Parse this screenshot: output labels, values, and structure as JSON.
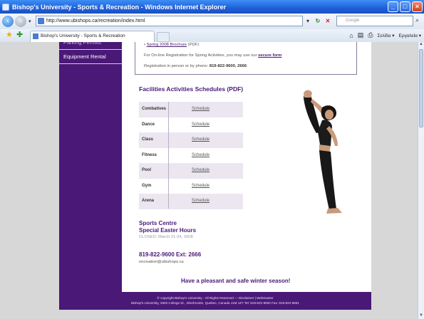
{
  "window": {
    "title": "Bishop's University - Sports & Recreation - Windows Internet Explorer"
  },
  "browser": {
    "url": "http://www.ubishops.ca/recreation/index.html",
    "search_placeholder": "Google",
    "tab_title": "Bishop's University - Sports & Recreation",
    "cmd_page": "Σελίδα",
    "cmd_tools": "Εργαλεία"
  },
  "sidebar": {
    "items": [
      {
        "label": "Parking Permits"
      },
      {
        "label": "Equipment Rental"
      }
    ]
  },
  "info": {
    "brochure_link": "Spring 2008 Brochure",
    "brochure_suffix": "(PDF)",
    "online_text": "For On-line Registration for Spring Activities, you may use our",
    "secure_link": "secure form",
    "phone_text": "Registration in person or by phone:",
    "phone_number": "819-822-9600, 2666"
  },
  "schedules": {
    "title": "Facilities Activities Schedules   (PDF)",
    "rows": [
      {
        "name": "Combatives",
        "link": "Schedule"
      },
      {
        "name": "Dance",
        "link": "Schedule"
      },
      {
        "name": "Class",
        "link": "Schedule"
      },
      {
        "name": "Fitness",
        "link": "Schedule"
      },
      {
        "name": "Pool",
        "link": "Schedule"
      },
      {
        "name": "Gym",
        "link": "Schedule"
      },
      {
        "name": "Arena",
        "link": "Schedule"
      }
    ]
  },
  "centre": {
    "line1": "Sports Centre",
    "line2": "Special Easter Hours",
    "closed": "CLOSED: March 21-24, 2008",
    "phone": "819-822-9600 Ext: 2666",
    "email": "recreation@ubishops.ca"
  },
  "season_message": "Have a pleasant and safe winter season!",
  "footer": {
    "line1": "© copyright Bishop's University - All Rights Reserved   —   Disclaimer  |  Webmaster",
    "line2": "Bishop's University, 2600 College St., Sherbrooke, Quebec, Canada J1M 1Z7   Tel: 819-822-9600   Fax: 819-822-9661"
  },
  "colors": {
    "brand_purple": "#4a1877",
    "page_bg": "#d7d7d7"
  }
}
